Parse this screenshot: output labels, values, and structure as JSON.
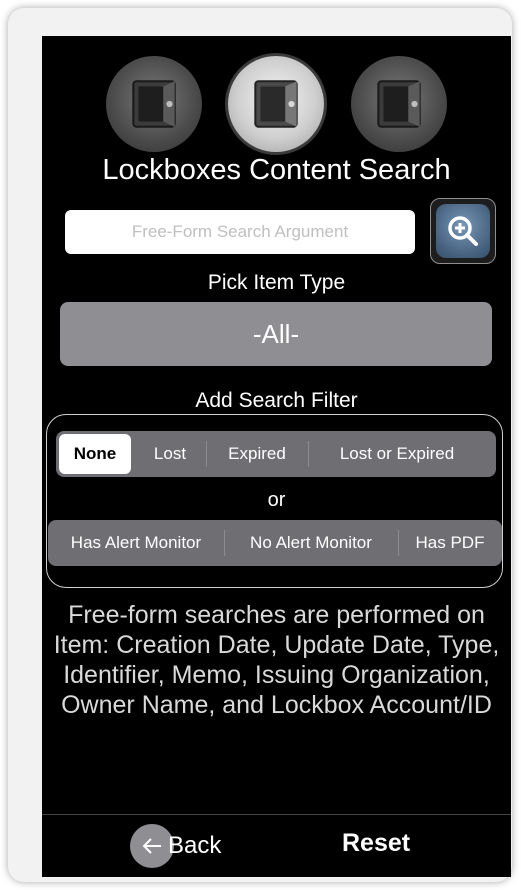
{
  "vaults": [
    {
      "icon": "safe-icon",
      "active": false
    },
    {
      "icon": "safe-icon",
      "active": true
    },
    {
      "icon": "safe-icon",
      "active": false
    }
  ],
  "title": "Lockboxes Content Search",
  "search": {
    "placeholder": "Free-Form Search Argument",
    "value": "",
    "button_icon": "zoom-in-icon"
  },
  "item_type": {
    "label": "Pick Item Type",
    "selected": "-All-"
  },
  "filter": {
    "label": "Add Search Filter",
    "row1": [
      "None",
      "Lost",
      "Expired",
      "Lost or Expired"
    ],
    "row1_selected": "None",
    "or_label": "or",
    "row2": [
      "Has Alert Monitor",
      "No Alert Monitor",
      "Has PDF"
    ]
  },
  "info_text": "Free-form searches are performed on Item: Creation Date, Update Date, Type, Identifier, Memo, Issuing Organization, Owner Name, and Lockbox Account/ID",
  "bottom": {
    "back_label": "Back",
    "reset_label": "Reset"
  },
  "colors": {
    "background": "#000000",
    "picker": "#8e8e93",
    "segment": "#6e6e73",
    "search_button": "#46627f"
  }
}
